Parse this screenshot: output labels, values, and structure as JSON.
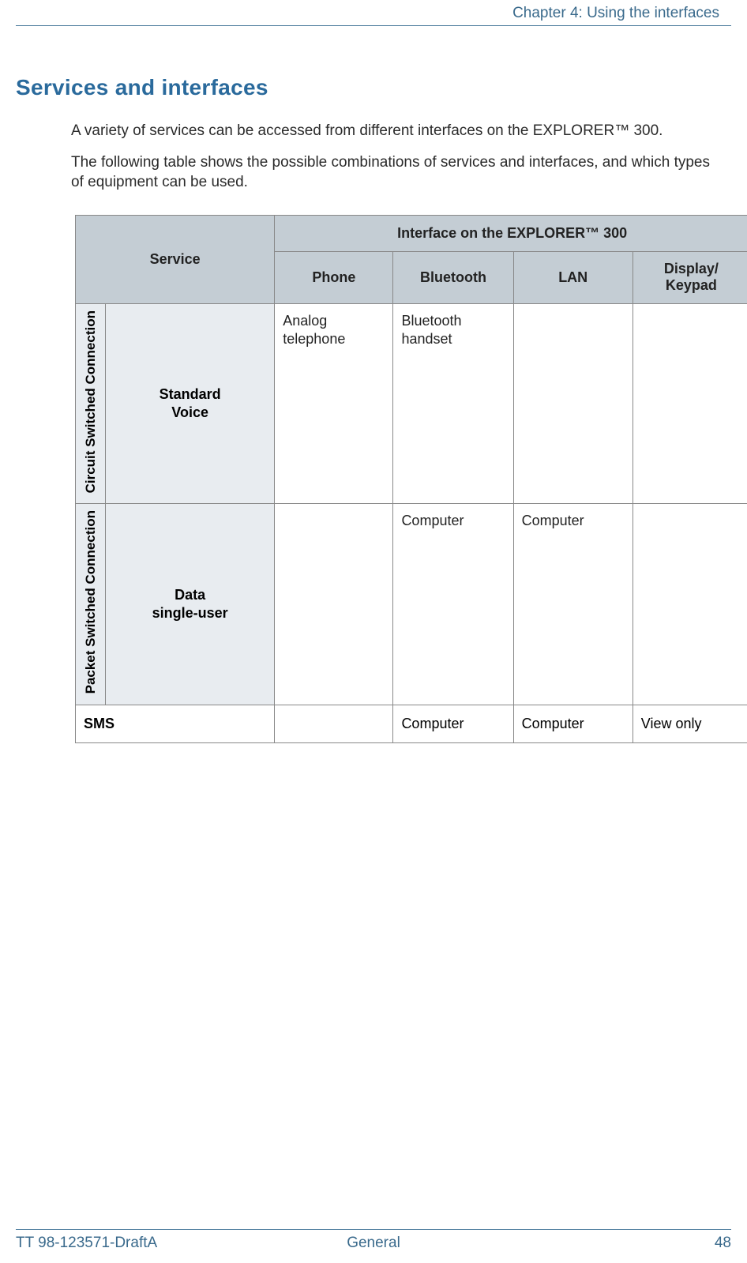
{
  "header": {
    "chapter": "Chapter 4: Using the interfaces"
  },
  "section": {
    "title": "Services and interfaces",
    "para1": "A variety of services can be accessed from different interfaces on the EXPLORER™ 300.",
    "para2": "The following table shows the possible combinations of services and interfaces, and which types of equipment can be used."
  },
  "table": {
    "head": {
      "service": "Service",
      "interface_span": "Interface on the EXPLORER™ 300",
      "cols": {
        "phone": "Phone",
        "bluetooth": "Bluetooth",
        "lan": "LAN",
        "display": "Display/\nKeypad"
      }
    },
    "rows": {
      "r1": {
        "category": "Circuit Switched Connection",
        "service": "Standard\nVoice",
        "phone": "Analog telephone",
        "bluetooth": "Bluetooth handset",
        "lan": "",
        "display": ""
      },
      "r2": {
        "category": "Packet Switched Connection",
        "service": "Data\nsingle-user",
        "phone": "",
        "bluetooth": "Computer",
        "lan": "Computer",
        "display": ""
      },
      "r3": {
        "service": "SMS",
        "phone": "",
        "bluetooth": "Computer",
        "lan": "Computer",
        "display": "View only"
      }
    }
  },
  "footer": {
    "left": "TT 98-123571-DraftA",
    "center": "General",
    "right": "48"
  }
}
